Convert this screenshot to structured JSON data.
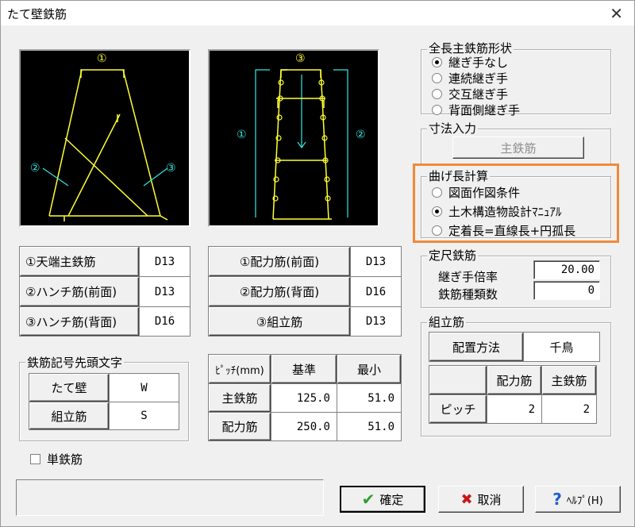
{
  "window": {
    "title": "たて壁鉄筋",
    "close_glyph": "✕"
  },
  "diagram_left": {
    "label1": "①",
    "label2": "②",
    "label3": "③"
  },
  "diagram_right": {
    "label1": "①",
    "label2": "②",
    "label3": "③"
  },
  "left_table": {
    "rows": [
      {
        "label": "①天端主鉄筋",
        "value": "D13"
      },
      {
        "label": "②ハンチ筋(前面)",
        "value": "D13"
      },
      {
        "label": "③ハンチ筋(背面)",
        "value": "D16"
      }
    ]
  },
  "middle_table": {
    "rows": [
      {
        "label": "①配力筋(前面)",
        "value": "D13"
      },
      {
        "label": "②配力筋(背面)",
        "value": "D16"
      },
      {
        "label": "③組立筋",
        "value": "D13"
      }
    ]
  },
  "rebar_prefix": {
    "title": "鉄筋記号先頭文字",
    "rows": [
      {
        "label": "たて壁",
        "value": "W"
      },
      {
        "label": "組立筋",
        "value": "S"
      }
    ]
  },
  "pitch_table": {
    "header": [
      "ﾋﾟｯﾁ(mm)",
      "基準",
      "最小"
    ],
    "rows": [
      {
        "label": "主鉄筋",
        "base": "125.0",
        "min": "51.0"
      },
      {
        "label": "配力筋",
        "base": "250.0",
        "min": "51.0"
      }
    ]
  },
  "single_rebar": {
    "label": "単鉄筋",
    "checked": false
  },
  "full_length": {
    "title": "全長主鉄筋形状",
    "options": [
      "継ぎ手なし",
      "連続継ぎ手",
      "交互継ぎ手",
      "背面側継ぎ手"
    ],
    "selected": 0
  },
  "dimension_input": {
    "title": "寸法入力",
    "button_label": "主鉄筋"
  },
  "bend_length": {
    "title": "曲げ長計算",
    "options": [
      "図面作図条件",
      "土木構造物設計ﾏﾆｭｱﾙ",
      "定着長=直線長+円孤長"
    ],
    "selected": 1
  },
  "fixed_length": {
    "title": "定尺鉄筋",
    "joint_label": "継ぎ手倍率",
    "joint_value": "20.00",
    "types_label": "鉄筋種類数",
    "types_value": "0"
  },
  "assembly": {
    "title": "組立筋",
    "layout_label": "配置方法",
    "layout_value": "千鳥",
    "col1": "配力筋",
    "col2": "主鉄筋",
    "row_label": "ピッチ",
    "v1": "2",
    "v2": "2"
  },
  "footer": {
    "ok_label": "確定",
    "cancel_label": "取消",
    "help_label": "ﾍﾙﾌﾟ(H)"
  },
  "colors": {
    "yellow": "#ffff33",
    "cyan": "#33e6e6",
    "accent": "#f08a3a"
  }
}
